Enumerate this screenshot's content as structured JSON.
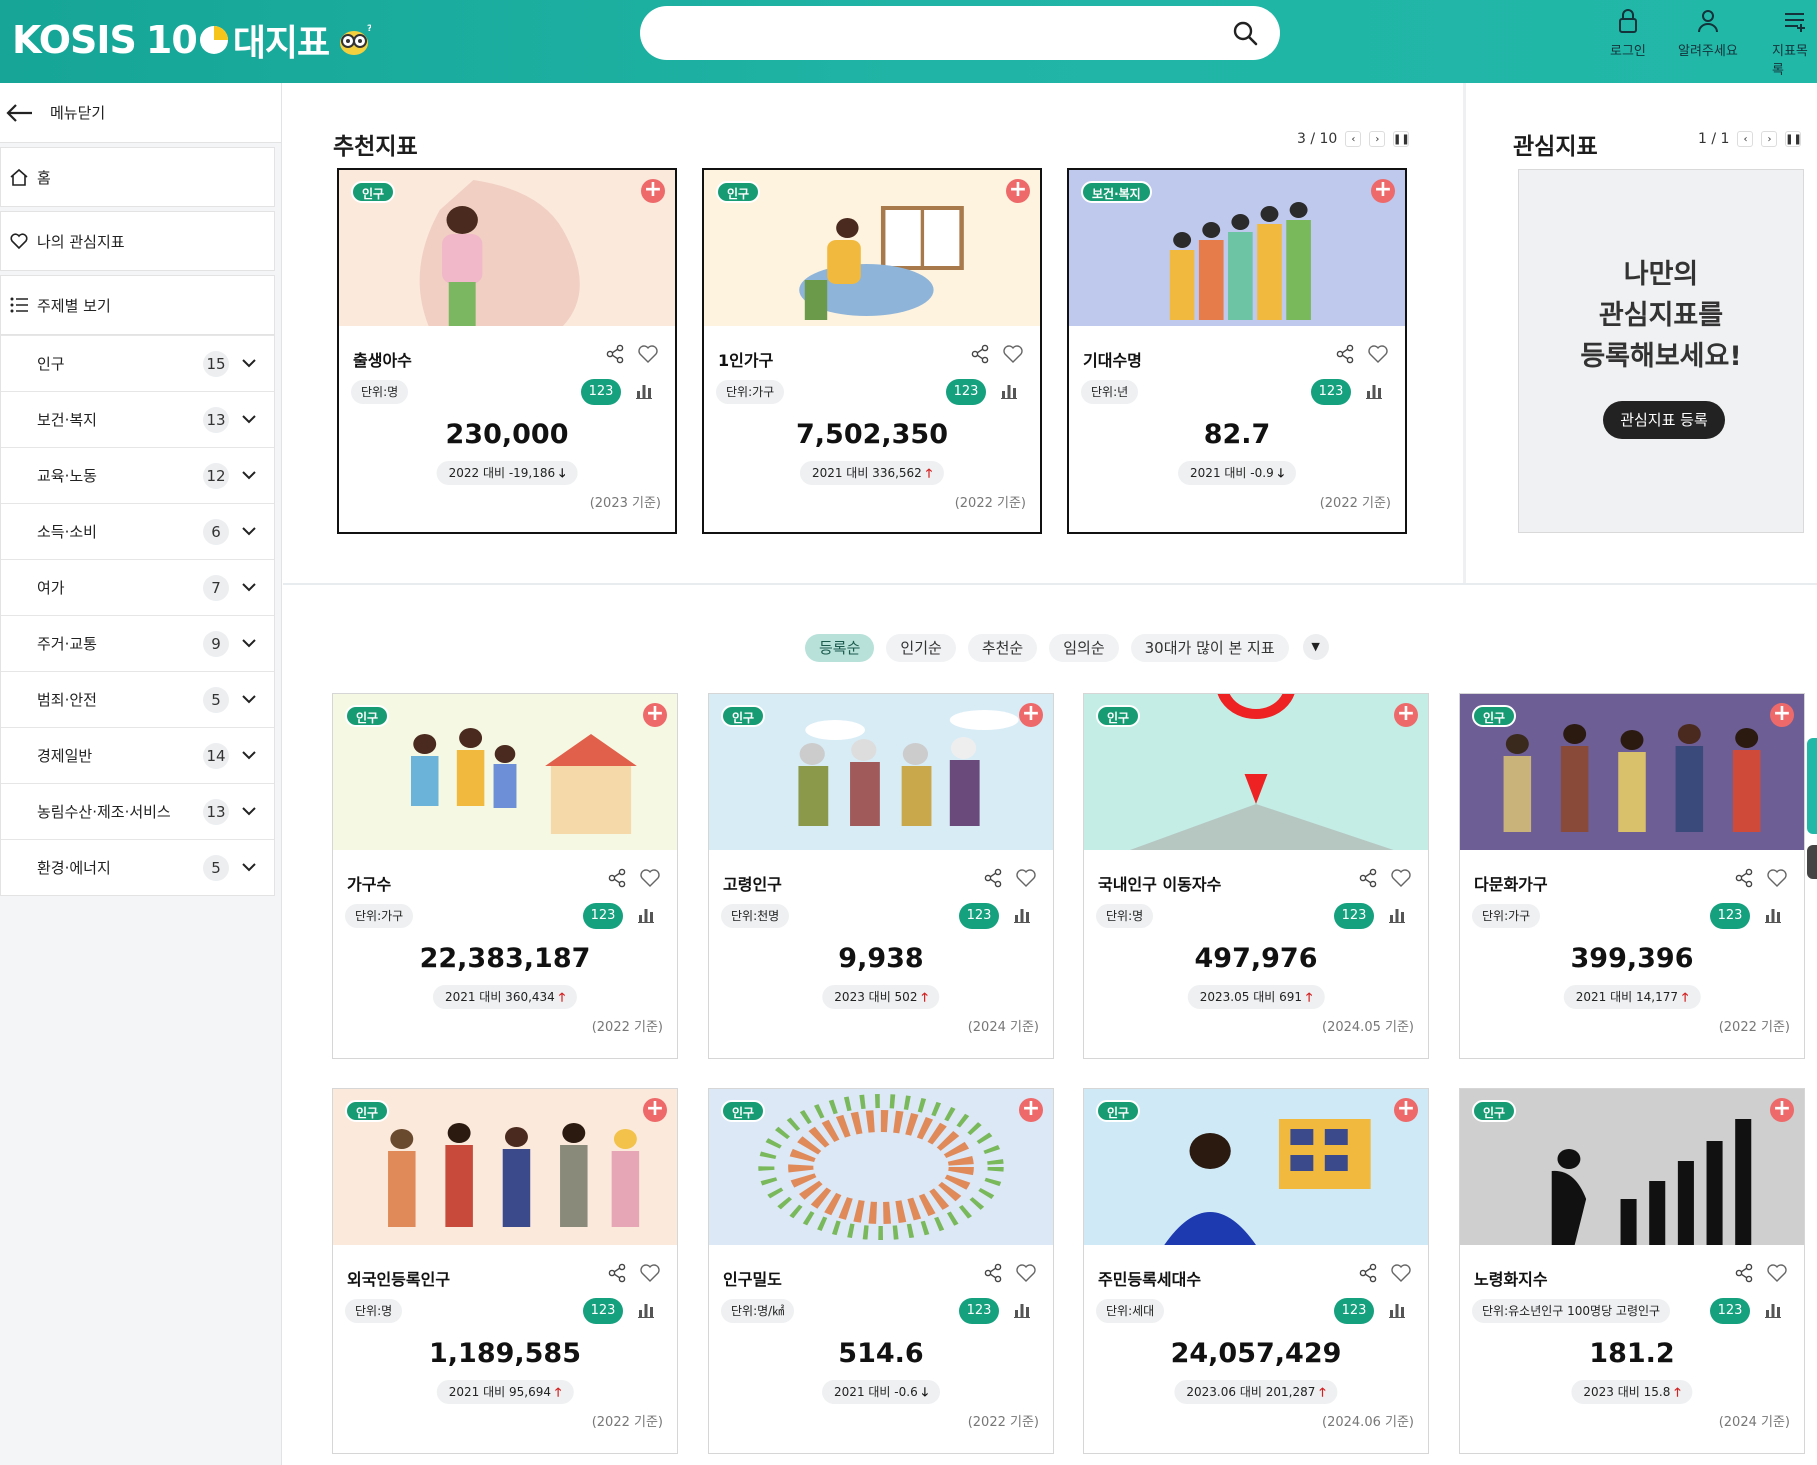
{
  "header": {
    "logo_text": "KOSIS 100대지표",
    "logo_prefix": "KOSIS",
    "logo_number": "10",
    "logo_suffix": "대지표",
    "search_placeholder": "",
    "nav": [
      {
        "label": "로그인",
        "icon": "lock-icon"
      },
      {
        "label": "알려주세요",
        "icon": "user-icon"
      },
      {
        "label": "지표목록",
        "icon": "list-icon"
      }
    ]
  },
  "sidebar": {
    "close_label": "메뉴닫기",
    "home_label": "홈",
    "my_interest_label": "나의 관심지표",
    "by_theme_label": "주제별 보기",
    "categories": [
      {
        "label": "인구",
        "count": "15"
      },
      {
        "label": "보건·복지",
        "count": "13"
      },
      {
        "label": "교육·노동",
        "count": "12"
      },
      {
        "label": "소득·소비",
        "count": "6"
      },
      {
        "label": "여가",
        "count": "7"
      },
      {
        "label": "주거·교통",
        "count": "9"
      },
      {
        "label": "범죄·안전",
        "count": "5"
      },
      {
        "label": "경제일반",
        "count": "14"
      },
      {
        "label": "농림수산·제조·서비스",
        "count": "13"
      },
      {
        "label": "환경·에너지",
        "count": "5"
      }
    ]
  },
  "recommended": {
    "title": "추천지표",
    "pager": "3 / 10",
    "cards": [
      {
        "tag": "인구",
        "name": "출생아수",
        "unit": "단위:명",
        "badge": "123",
        "value": "230,000",
        "change": "2022 대비 -19,186",
        "dir": "down",
        "basis": "(2023 기준)"
      },
      {
        "tag": "인구",
        "name": "1인가구",
        "unit": "단위:가구",
        "badge": "123",
        "value": "7,502,350",
        "change": "2021 대비 336,562",
        "dir": "up",
        "basis": "(2022 기준)"
      },
      {
        "tag": "보건·복지",
        "name": "기대수명",
        "unit": "단위:년",
        "badge": "123",
        "value": "82.7",
        "change": "2021 대비 -0.9",
        "dir": "down",
        "basis": "(2022 기준)"
      }
    ]
  },
  "interest": {
    "title": "관심지표",
    "pager": "1 / 1",
    "message_line1": "나만의",
    "message_line2": "관심지표를",
    "message_line3": "등록해보세요!",
    "register_label": "관심지표 등록"
  },
  "sort_tabs": [
    "등록순",
    "인기순",
    "추천순",
    "임의순",
    "30대가 많이 본 지표"
  ],
  "grid": [
    {
      "tag": "인구",
      "name": "가구수",
      "unit": "단위:가구",
      "badge": "123",
      "value": "22,383,187",
      "change": "2021 대비 360,434",
      "dir": "up",
      "basis": "(2022 기준)"
    },
    {
      "tag": "인구",
      "name": "고령인구",
      "unit": "단위:천명",
      "badge": "123",
      "value": "9,938",
      "change": "2023 대비 502",
      "dir": "up",
      "basis": "(2024 기준)"
    },
    {
      "tag": "인구",
      "name": "국내인구 이동자수",
      "unit": "단위:명",
      "badge": "123",
      "value": "497,976",
      "change": "2023.05 대비 691",
      "dir": "up",
      "basis": "(2024.05 기준)"
    },
    {
      "tag": "인구",
      "name": "다문화가구",
      "unit": "단위:가구",
      "badge": "123",
      "value": "399,396",
      "change": "2021 대비 14,177",
      "dir": "up",
      "basis": "(2022 기준)"
    },
    {
      "tag": "인구",
      "name": "외국인등록인구",
      "unit": "단위:명",
      "badge": "123",
      "value": "1,189,585",
      "change": "2021 대비 95,694",
      "dir": "up",
      "basis": "(2022 기준)"
    },
    {
      "tag": "인구",
      "name": "인구밀도",
      "unit": "단위:명/㎢",
      "badge": "123",
      "value": "514.6",
      "change": "2021 대비 -0.6",
      "dir": "down",
      "basis": "(2022 기준)"
    },
    {
      "tag": "인구",
      "name": "주민등록세대수",
      "unit": "단위:세대",
      "badge": "123",
      "value": "24,057,429",
      "change": "2023.06 대비 201,287",
      "dir": "up",
      "basis": "(2024.06 기준)"
    },
    {
      "tag": "인구",
      "name": "노령화지수",
      "unit": "단위:유소년인구 100명당 고령인구",
      "badge": "123",
      "value": "181.2",
      "change": "2023 대비 15.8",
      "dir": "up",
      "basis": "(2024 기준)"
    }
  ],
  "colors": {
    "header": "#1fb4a5",
    "tag": "#179b72",
    "plus": "#ee6a6a",
    "up_arrow": "#d32020"
  }
}
